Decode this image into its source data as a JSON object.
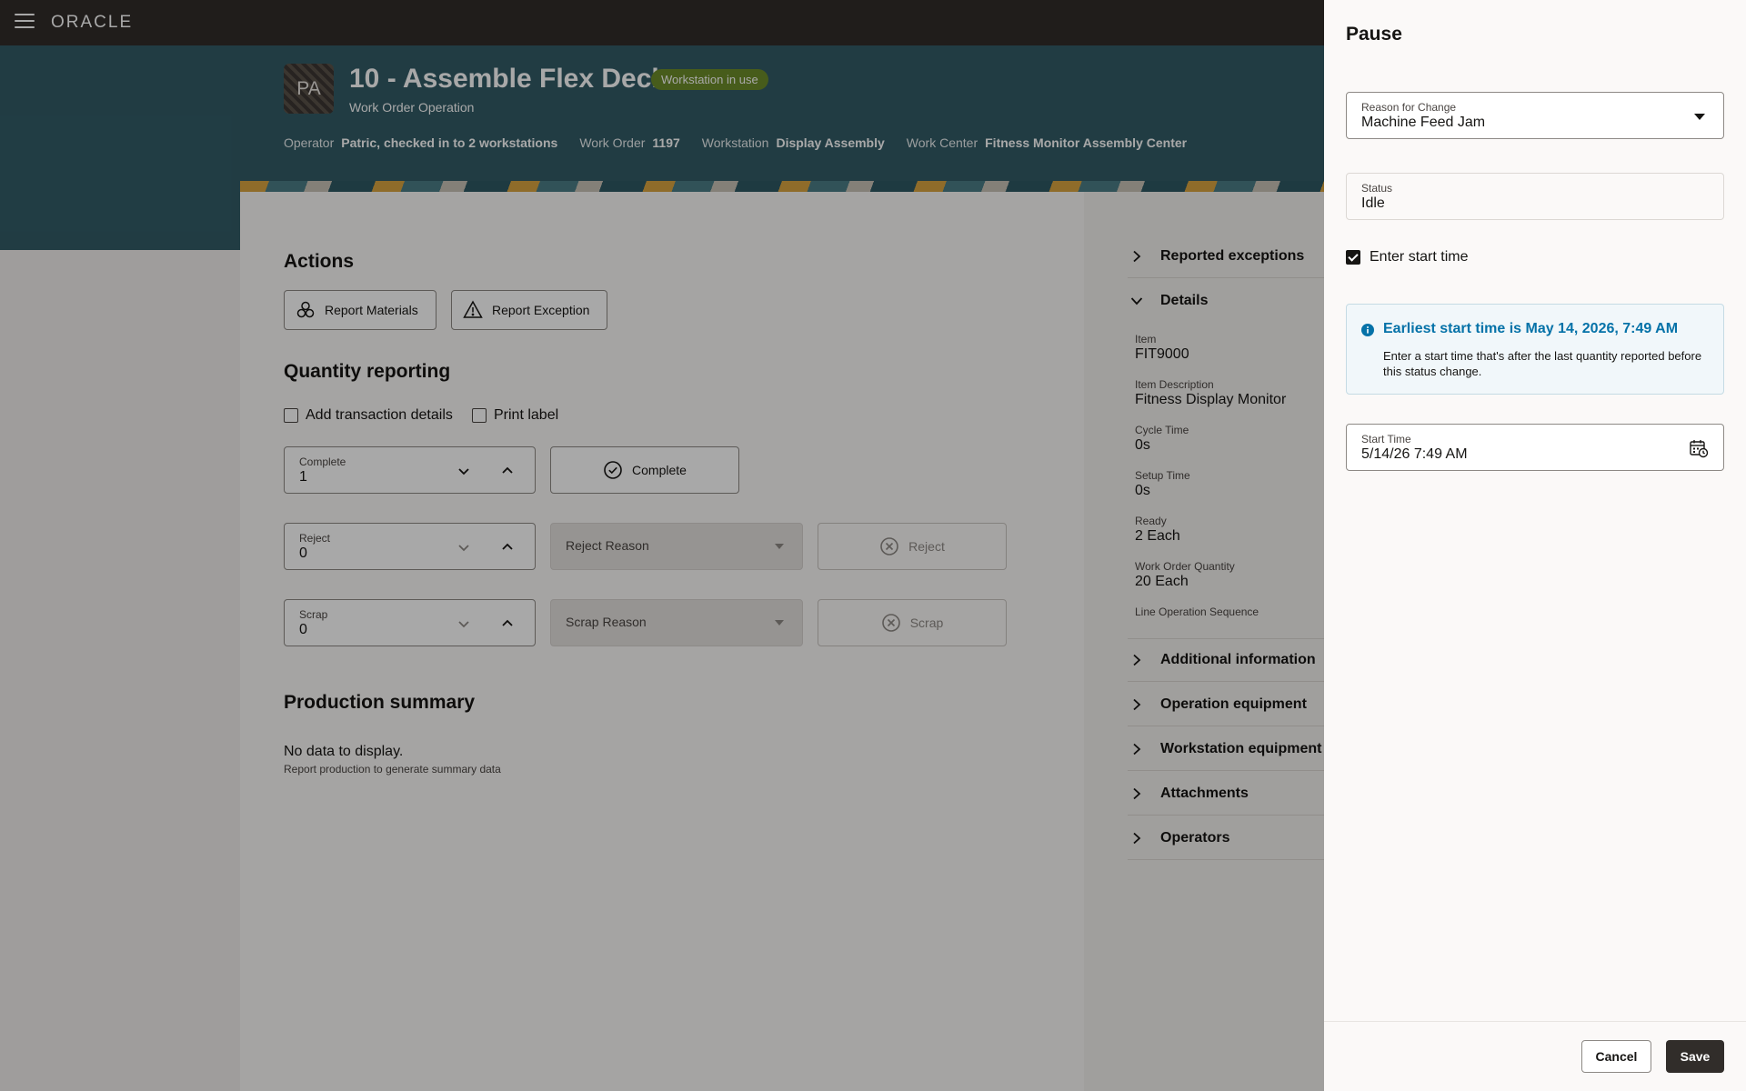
{
  "app": {
    "logo": "ORACLE"
  },
  "header": {
    "avatar_initials": "PA",
    "title": "10 - Assemble Flex Deck",
    "badge": "Workstation in use",
    "subtitle": "Work Order Operation",
    "meta": [
      {
        "label": "Operator",
        "value": "Patric, checked in to 2 workstations"
      },
      {
        "label": "Work Order",
        "value": "1197"
      },
      {
        "label": "Workstation",
        "value": "Display Assembly"
      },
      {
        "label": "Work Center",
        "value": "Fitness Monitor Assembly Center"
      }
    ]
  },
  "actions": {
    "title": "Actions",
    "report_materials": "Report Materials",
    "report_exception": "Report Exception"
  },
  "quantity": {
    "title": "Quantity reporting",
    "add_details": "Add transaction details",
    "print_label": "Print label",
    "complete": {
      "label": "Complete",
      "value": "1",
      "button": "Complete"
    },
    "reject": {
      "label": "Reject",
      "value": "0",
      "reason_placeholder": "Reject Reason",
      "button": "Reject"
    },
    "scrap": {
      "label": "Scrap",
      "value": "0",
      "reason_placeholder": "Scrap Reason",
      "button": "Scrap"
    }
  },
  "production_summary": {
    "title": "Production summary",
    "empty": "No data to display.",
    "empty_sub": "Report production to generate summary data"
  },
  "right_panel": {
    "reported_exceptions": "Reported exceptions",
    "details": "Details",
    "fields": [
      {
        "label": "Item",
        "value": "FIT9000"
      },
      {
        "label": "Item Description",
        "value": "Fitness Display Monitor"
      },
      {
        "label": "Cycle Time",
        "value": "0s"
      },
      {
        "label": "Setup Time",
        "value": "0s"
      },
      {
        "label": "Ready",
        "value": "2 Each"
      },
      {
        "label": "Work Order Quantity",
        "value": "20 Each"
      },
      {
        "label": "Line Operation Sequence",
        "value": ""
      }
    ],
    "sections": [
      "Additional information",
      "Operation equipment",
      "Workstation equipment",
      "Attachments",
      "Operators"
    ]
  },
  "drawer": {
    "title": "Pause",
    "reason": {
      "label": "Reason for Change",
      "value": "Machine Feed Jam"
    },
    "status": {
      "label": "Status",
      "value": "Idle"
    },
    "enter_start_time": "Enter start time",
    "info": {
      "title": "Earliest start time is May 14, 2026, 7:49 AM",
      "text": "Enter a start time that's after the last quantity reported before this status change."
    },
    "start_time": {
      "label": "Start Time",
      "value": "5/14/26 7:49 AM"
    },
    "cancel": "Cancel",
    "save": "Save"
  },
  "colors": {
    "topbar": "#312d2a",
    "header": "#325c67",
    "badge": "#6d8c2a",
    "info_accent": "#0572a8"
  }
}
